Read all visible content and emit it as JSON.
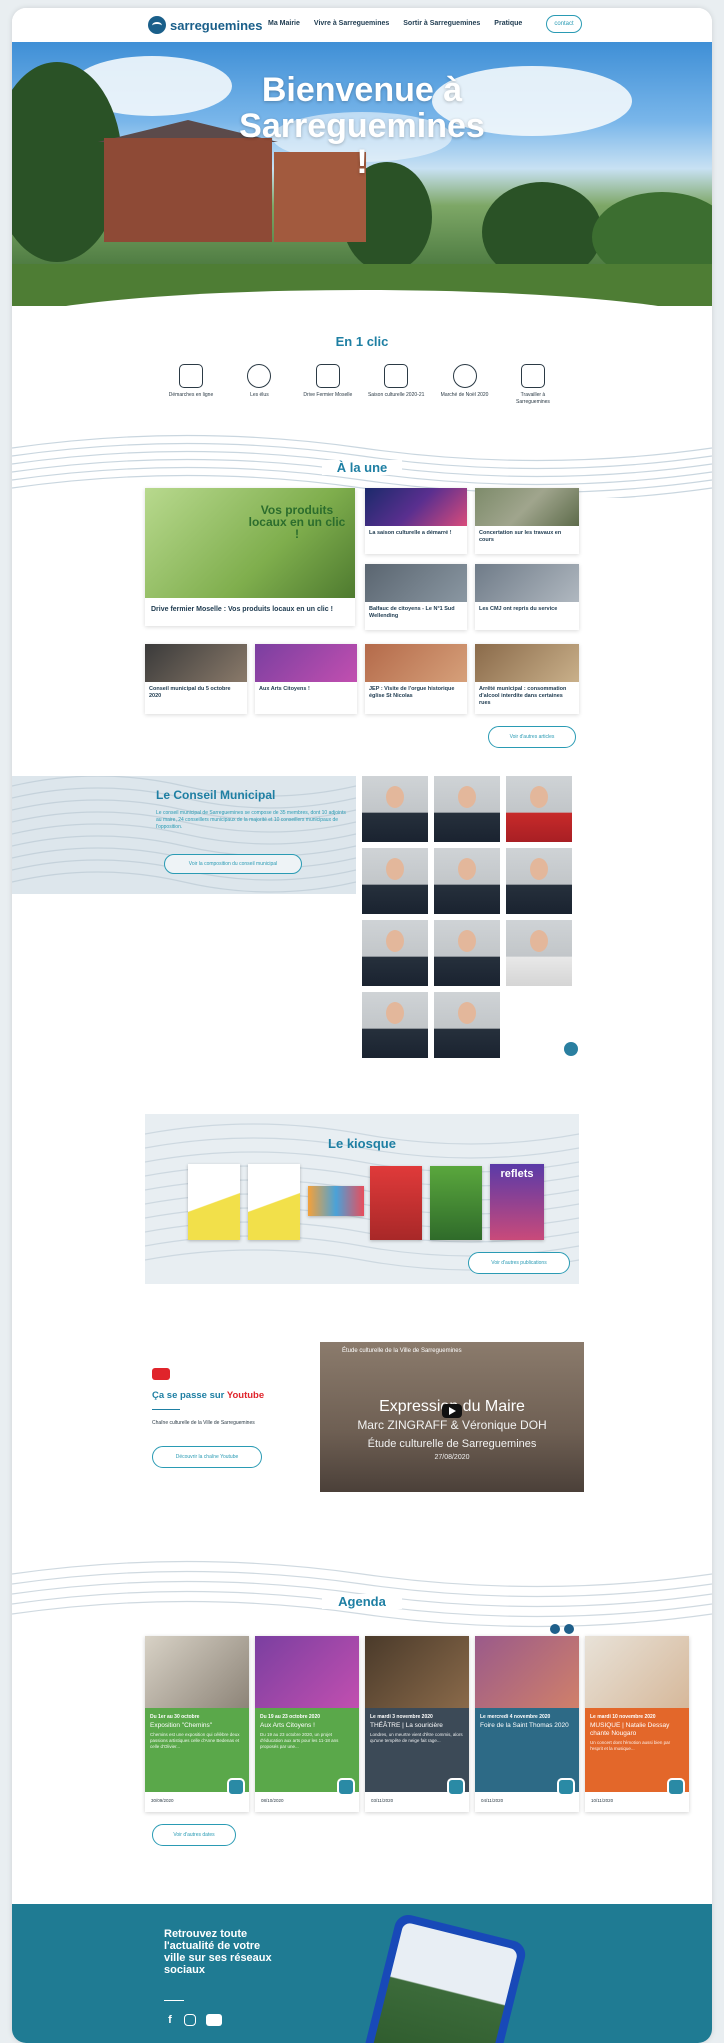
{
  "nav": {
    "logo": "sarreguemines",
    "menu": [
      "Ma Mairie",
      "Vivre à Sarreguemines",
      "Sortir à Sarreguemines",
      "Pratique"
    ],
    "contact": "contact"
  },
  "hero": {
    "title": "Bienvenue à Sarreguemines !"
  },
  "clic": {
    "title": "En 1 clic",
    "items": [
      "Démarches en ligne",
      "Les élus",
      "Drive Fermier Moselle",
      "Saison culturelle 2020-21",
      "Marché de Noël 2020",
      "Travailler à Sarreguemines"
    ]
  },
  "une": {
    "title": "À la une",
    "promo": "Vos produits locaux en un clic !",
    "big": "Drive fermier Moselle : Vos produits locaux en un clic !",
    "cards": [
      "La saison culturelle a démarré !",
      "Concertation sur les travaux en cours",
      "Balfauc de citoyens - Le N°1 Sud Wellending",
      "Les CMJ ont repris du service",
      "Conseil municipal du 5 octobre 2020",
      "Aux Arts Citoyens !",
      "JEP : Visite de l'orgue historique église St Nicolas",
      "Arrêté municipal : consommation d'alcool interdite dans certaines rues"
    ],
    "more": "Voir d'autres articles"
  },
  "conseil": {
    "title": "Le Conseil Municipal",
    "text": "Le conseil municipal de Sarreguemines se compose de 35 membres, dont 10 adjoints au maire, 24 conseillers municipaux de la majorité et 10 conseillers municipaux de l'opposition.",
    "more": "Voir la composition du conseil municipal"
  },
  "kiosque": {
    "title": "Le kiosque",
    "more": "Voir d'autres publications",
    "mag": "reflets"
  },
  "youtube": {
    "title_main": "Ça se passe sur ",
    "title_brand": "Youtube",
    "channel": "Chaîne culturelle de la Ville de Sarreguemines",
    "more": "Découvrir la chaîne Youtube",
    "video": {
      "head": "Étude culturelle de la Ville de Sarreguemines",
      "t1": "Expression du Maire",
      "t2": "Marc ZINGRAFF & Véronique DOH",
      "t3": "Étude culturelle de Sarreguemines",
      "t4": "27/08/2020"
    }
  },
  "agenda": {
    "title": "Agenda",
    "more": "Voir d'autres dates",
    "cards": [
      {
        "date": "Du 1er au 30 octobre",
        "title": "Exposition \"Chemins\"",
        "desc": "Chemins est une exposition qui célèbre deux passions artistiques celle d'Anne Bedenas et celle d'Olivier...",
        "foot": "30/09/2020",
        "color": "#5aa84a"
      },
      {
        "date": "Du 19 au 23 octobre 2020",
        "title": "Aux Arts Citoyens !",
        "desc": "Du 19 au 23 octobre 2020, un projet d'éducation aux arts pour les 11-18 ans proposés par une...",
        "foot": "08/10/2020",
        "color": "#5aa84a"
      },
      {
        "date": "Le mardi 3 novembre 2020",
        "title": "THÉÂTRE | La souricière",
        "desc": "Londres, un meurtre vient d'être commis, alors qu'une tempête de neige fait rage...",
        "foot": "03/11/2020",
        "color": "#3c4a57"
      },
      {
        "date": "Le mercredi 4 novembre 2020",
        "title": "Foire de la Saint Thomas 2020",
        "desc": "",
        "foot": "04/11/2020",
        "color": "#2d6a86"
      },
      {
        "date": "Le mardi 10 novembre 2020",
        "title": "MUSIQUE | Natalie Dessay chante Nougaro",
        "desc": "Un concert dont l'émotion aussi bien par l'esprit et la musique...",
        "foot": "10/11/2020",
        "color": "#e3672a"
      }
    ]
  },
  "footer": {
    "text": "Retrouvez toute l'actualité de votre ville sur ses réseaux sociaux"
  }
}
